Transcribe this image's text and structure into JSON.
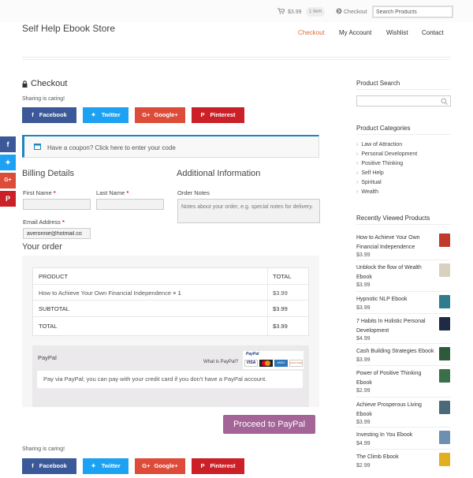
{
  "topbar": {
    "cart_total": "$3.99",
    "cart_count": "1 item",
    "checkout_label": "Checkout",
    "search_placeholder": "Search Products"
  },
  "header": {
    "site_title": "Self Help Ebook Store",
    "nav": [
      "Checkout",
      "My Account",
      "Wishlist",
      "Contact"
    ],
    "active_nav": "Checkout"
  },
  "checkout": {
    "title": "Checkout",
    "sharing_text": "Sharing is caring!",
    "share_buttons": [
      "Facebook",
      "Twitter",
      "Google+",
      "Pinterest"
    ],
    "coupon_text": "Have a coupon? Click here to enter your code"
  },
  "billing": {
    "heading": "Billing Details",
    "first_name_label": "First Name",
    "last_name_label": "Last Name",
    "email_label": "Email Address",
    "required_mark": "*",
    "email_value": "averonnie@hotmail.co"
  },
  "additional": {
    "heading": "Additional Information",
    "notes_label": "Order Notes",
    "notes_placeholder": "Notes about your order, e.g. special notes for delivery."
  },
  "order": {
    "heading": "Your order",
    "col_product": "PRODUCT",
    "col_total": "TOTAL",
    "item_name": "How to Achieve Your Own Financial Independence",
    "item_qty": "× 1",
    "item_total": "$3.99",
    "subtotal_label": "SUBTOTAL",
    "subtotal_value": "$3.99",
    "total_label": "TOTAL",
    "total_value": "$3.99"
  },
  "payment": {
    "method": "PayPal",
    "what_is": "What is PayPal?",
    "description": "Pay via PayPal; you can pay with your credit card if you don't have a PayPal account.",
    "proceed_label": "Proceed to PayPal",
    "card_logo_paypal": "PayPal",
    "card_logo_visa": "VISA",
    "card_logo_amex": "AMEX",
    "card_logo_discover": "DISCOVER"
  },
  "sidebar": {
    "search_heading": "Product Search",
    "categories_heading": "Product Categories",
    "categories": [
      "Law of Attraction",
      "Personal Development",
      "Positive Thinking",
      "Self Help",
      "Spiritual",
      "Wealth"
    ],
    "recent_heading": "Recently Viewed Products",
    "recent": [
      {
        "title": "How to Achieve Your Own Financial Independence",
        "price": "$3.99",
        "color": "#c0392b"
      },
      {
        "title": "Unblock the flow of Wealth Ebook",
        "price": "$3.99",
        "color": "#d9d0c0"
      },
      {
        "title": "Hypnotic NLP Ebook",
        "price": "$3.99",
        "color": "#2e7d8c"
      },
      {
        "title": "7 Habits In Holistic Personal Development",
        "price": "$4.99",
        "color": "#1f2a44"
      },
      {
        "title": "Cash Building Strategies Ebook",
        "price": "$3.99",
        "color": "#2d5a3a"
      },
      {
        "title": "Power of Positive Thinking Ebook",
        "price": "$2.99",
        "color": "#3a6f4a"
      },
      {
        "title": "Achieve Prosperous Living Ebook",
        "price": "$3.99",
        "color": "#4a6a7a"
      },
      {
        "title": "Investing In You Ebook",
        "price": "$4.99",
        "color": "#6d8fb0"
      },
      {
        "title": "The Climb Ebook",
        "price": "$2.99",
        "color": "#e0b020"
      }
    ]
  },
  "colors": {
    "accent": "#e16b39",
    "facebook": "#3b5998",
    "twitter": "#1da1f2",
    "googleplus": "#dd4b39",
    "pinterest": "#cb2027",
    "proceed": "#a46497",
    "coupon_border": "#1e85be"
  }
}
